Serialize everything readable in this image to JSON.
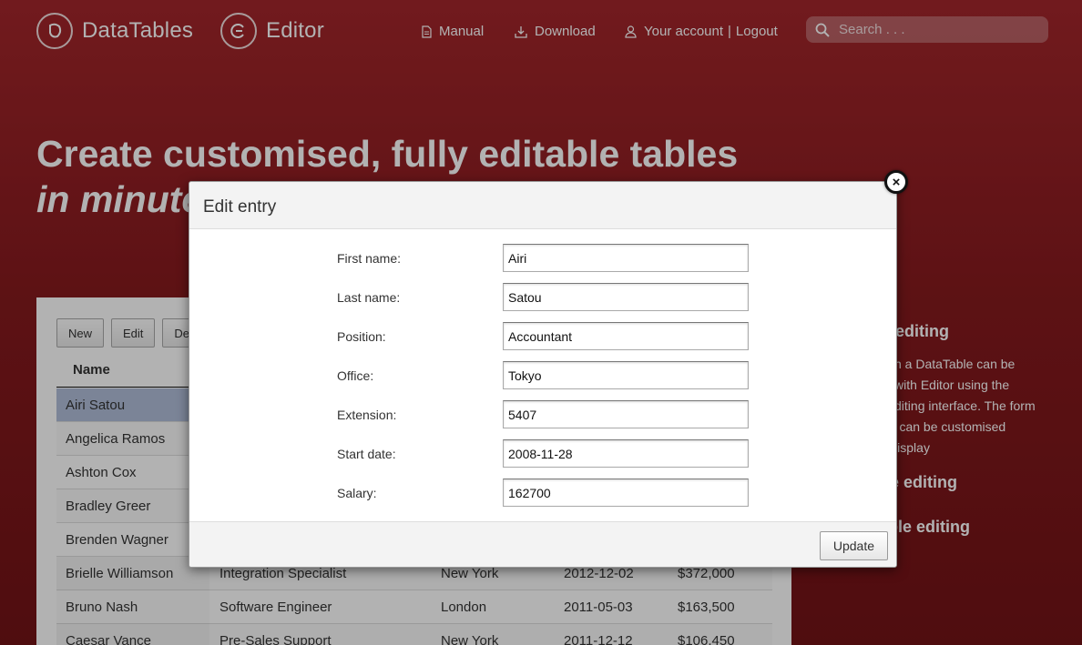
{
  "header": {
    "logo_datatables": "DataTables",
    "logo_editor": "Editor",
    "nav": {
      "manual": "Manual",
      "download": "Download",
      "your_account": "Your account",
      "separator": "|",
      "logout": "Logout"
    },
    "search": {
      "placeholder": "Search . . ."
    }
  },
  "hero": {
    "line1": "Create customised, fully editable tables",
    "line2": "in minutes"
  },
  "table": {
    "buttons": {
      "new": "New",
      "edit": "Edit",
      "delete": "Delete"
    },
    "columns": {
      "name": "Name"
    },
    "rows": [
      {
        "name": "Airi Satou",
        "position": "",
        "office": "",
        "start": "",
        "salary": "",
        "selected": true
      },
      {
        "name": "Angelica Ramos",
        "position": "",
        "office": "",
        "start": "",
        "salary": ""
      },
      {
        "name": "Ashton Cox",
        "position": "",
        "office": "",
        "start": "",
        "salary": ""
      },
      {
        "name": "Bradley Greer",
        "position": "",
        "office": "",
        "start": "",
        "salary": ""
      },
      {
        "name": "Brenden Wagner",
        "position": "",
        "office": "",
        "start": "",
        "salary": ""
      },
      {
        "name": "Brielle Williamson",
        "position": "Integration Specialist",
        "office": "New York",
        "start": "2012-12-02",
        "salary": "$372,000"
      },
      {
        "name": "Bruno Nash",
        "position": "Software Engineer",
        "office": "London",
        "start": "2011-05-03",
        "salary": "$163,500"
      },
      {
        "name": "Caesar Vance",
        "position": "Pre-Sales Support",
        "office": "New York",
        "start": "2011-12-12",
        "salary": "$106,450"
      }
    ]
  },
  "sidebar": {
    "heading1": "Row editing",
    "text1": "Rows in a DataTable can be edited with Editor using the main editing interface. The form display can be customised using display",
    "heading2": "Inline editing",
    "heading3": "Bubble editing"
  },
  "modal": {
    "title": "Edit entry",
    "fields": [
      {
        "label": "First name:",
        "value": "Airi"
      },
      {
        "label": "Last name:",
        "value": "Satou"
      },
      {
        "label": "Position:",
        "value": "Accountant"
      },
      {
        "label": "Office:",
        "value": "Tokyo"
      },
      {
        "label": "Extension:",
        "value": "5407"
      },
      {
        "label": "Start date:",
        "value": "2008-11-28"
      },
      {
        "label": "Salary:",
        "value": "162700"
      }
    ],
    "submit_label": "Update",
    "close_symbol": "×"
  }
}
